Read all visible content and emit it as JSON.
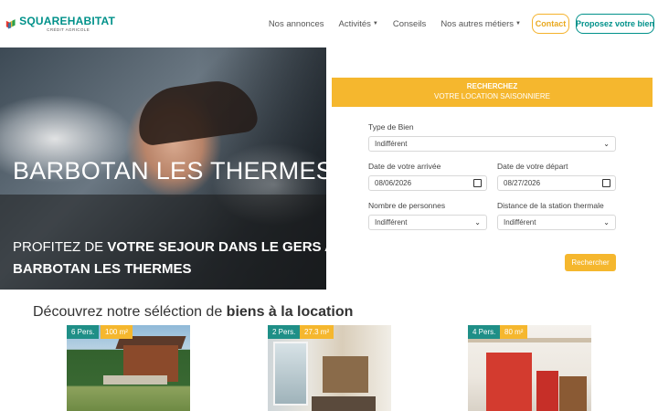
{
  "header": {
    "logo": {
      "name_part1": "SQUARE",
      "name_part2": "HABITAT",
      "subtitle": "CRÉDIT AGRICOLE"
    },
    "nav": [
      {
        "label": "Nos annonces",
        "has_caret": false
      },
      {
        "label": "Activités",
        "has_caret": true
      },
      {
        "label": "Conseils",
        "has_caret": false
      },
      {
        "label": "Nos autres métiers",
        "has_caret": true
      }
    ],
    "contact_label": "Contact",
    "propose_label": "Proposez votre bien"
  },
  "hero": {
    "title": "BARBOTAN LES THERMES",
    "line1_normal": "PROFITEZ DE ",
    "line1_bold": "VOTRE SEJOUR DANS LE GERS A",
    "line2_bold": "BARBOTAN LES THERMES"
  },
  "search": {
    "head_title": "RECHERCHEZ",
    "head_subtitle": "VOTRE LOCATION SAISONNIERE",
    "type_label": "Type de Bien",
    "type_value": "Indifférent",
    "arrival_label": "Date de votre arrivée",
    "arrival_value": "08/06/2026",
    "departure_label": "Date de votre départ",
    "departure_value": "08/27/2026",
    "persons_label": "Nombre de personnes",
    "persons_value": "Indifférent",
    "distance_label": "Distance de la station thermale",
    "distance_value": "Indifférent",
    "submit_label": "Rechercher"
  },
  "listing": {
    "title_normal": "Découvrez notre séléction de ",
    "title_bold": "biens à la location",
    "cards": [
      {
        "persons": "6 Pers.",
        "area": "100 m²"
      },
      {
        "persons": "2 Pers.",
        "area": "27.3 m²"
      },
      {
        "persons": "4 Pers.",
        "area": "80 m²"
      }
    ]
  },
  "colors": {
    "brand_teal": "#00918a",
    "accent_yellow": "#f5b72e"
  }
}
